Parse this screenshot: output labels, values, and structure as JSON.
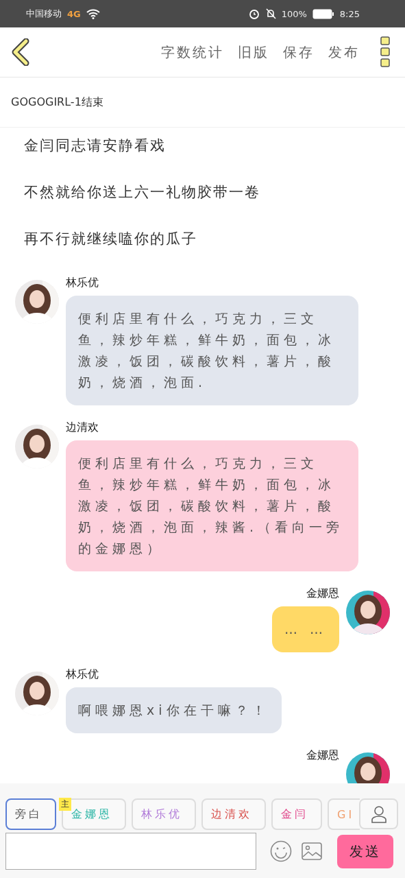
{
  "status_bar": {
    "carrier": "中国移动",
    "network": "4G",
    "battery": "100%",
    "time": "8:25"
  },
  "toolbar": {
    "actions": [
      "字数统计",
      "旧版",
      "保存",
      "发布"
    ]
  },
  "title": "GOGOGIRL-1结束",
  "messages": [
    {
      "kind": "narration",
      "text": "金闫同志请安静看戏"
    },
    {
      "kind": "narration",
      "text": "不然就给你送上六一礼物胶带一卷"
    },
    {
      "kind": "narration",
      "text": "再不行就继续嗑你的瓜子"
    },
    {
      "kind": "left",
      "name": "林乐优",
      "text": "便利店里有什么，巧克力，三文鱼，辣炒年糕，鲜牛奶，面包，冰激凌，饭团，碳酸饮料，薯片，酸奶，烧酒，泡面.",
      "color": "#e2e6ee"
    },
    {
      "kind": "left",
      "name": "边清欢",
      "text": "便利店里有什么，巧克力，三文鱼，辣炒年糕，鲜牛奶，面包，冰激凌，饭团，碳酸饮料，薯片，酸奶，烧酒，泡面，辣酱.（看向一旁的金娜恩）",
      "color": "#fdd0dc"
    },
    {
      "kind": "right",
      "name": "金娜恩",
      "text": "… …",
      "color": "#ffd966"
    },
    {
      "kind": "left",
      "name": "林乐优",
      "text": "啊喂娜恩xi你在干嘛？！",
      "color": "#e2e6ee"
    },
    {
      "kind": "right",
      "name": "金娜恩"
    }
  ],
  "roles": [
    {
      "label": "旁白",
      "color": "#555555",
      "selected": true
    },
    {
      "label": "金娜恩",
      "color": "#2bb5a5",
      "selected": false,
      "badge": "主"
    },
    {
      "label": "林乐优",
      "color": "#b07ad8",
      "selected": false
    },
    {
      "label": "边清欢",
      "color": "#d9534f",
      "selected": false
    },
    {
      "label": "金闫",
      "color": "#e0458a",
      "selected": false
    },
    {
      "label": "GI",
      "color": "#f0a070",
      "selected": false
    }
  ],
  "send_button": "发送"
}
